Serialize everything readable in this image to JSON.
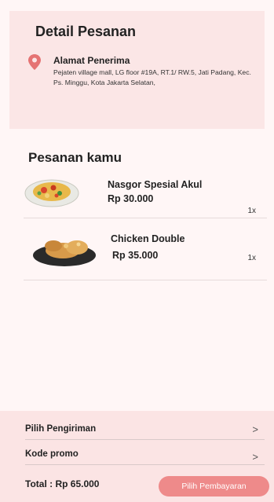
{
  "header": {
    "title": "Detail Pesanan"
  },
  "address": {
    "title": "Alamat Penerima",
    "text": "Pejaten village mall, LG floor #19A, RT.1/ RW.5, Jati Padang, Kec. Ps. Minggu, Kota Jakarta Selatan,",
    "icon": "location-pin-icon"
  },
  "orders": {
    "title": "Pesanan kamu",
    "items": [
      {
        "name": "Nasgor Spesial Akul",
        "price": "Rp 30.000",
        "qty": "1x"
      },
      {
        "name": "Chicken Double",
        "price": "Rp 35.000",
        "qty": "1x"
      }
    ]
  },
  "checkout": {
    "shipping_label": "Pilih Pengiriman",
    "promo_label": "Kode promo",
    "chevron": ">",
    "total_label": "Total : Rp 65.000",
    "pay_button": "Pilih Pembayaran"
  },
  "colors": {
    "accent": "#ee8a8a",
    "panel": "#fbe4e4",
    "pin": "#e57373"
  }
}
